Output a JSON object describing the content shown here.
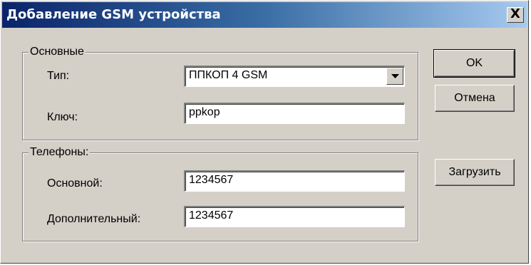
{
  "window": {
    "title": "Добавление GSM устройства",
    "close_icon": "close-icon",
    "close_glyph": "X"
  },
  "main_group": {
    "label": "Основные",
    "type_label": "Тип:",
    "type_value": "ППКОП 4 GSM",
    "key_label": "Ключ:",
    "key_value": "ppkop"
  },
  "phones_group": {
    "label": "Телефоны:",
    "primary_label": "Основной:",
    "primary_value": "1234567",
    "secondary_label": "Дополнительный:",
    "secondary_value": "1234567"
  },
  "buttons": {
    "ok": "OK",
    "cancel": "Отмена",
    "load": "Загрузить"
  },
  "colors": {
    "face": "#d4d0c8",
    "title_start": "#0a246a",
    "title_end": "#a6caf0"
  }
}
